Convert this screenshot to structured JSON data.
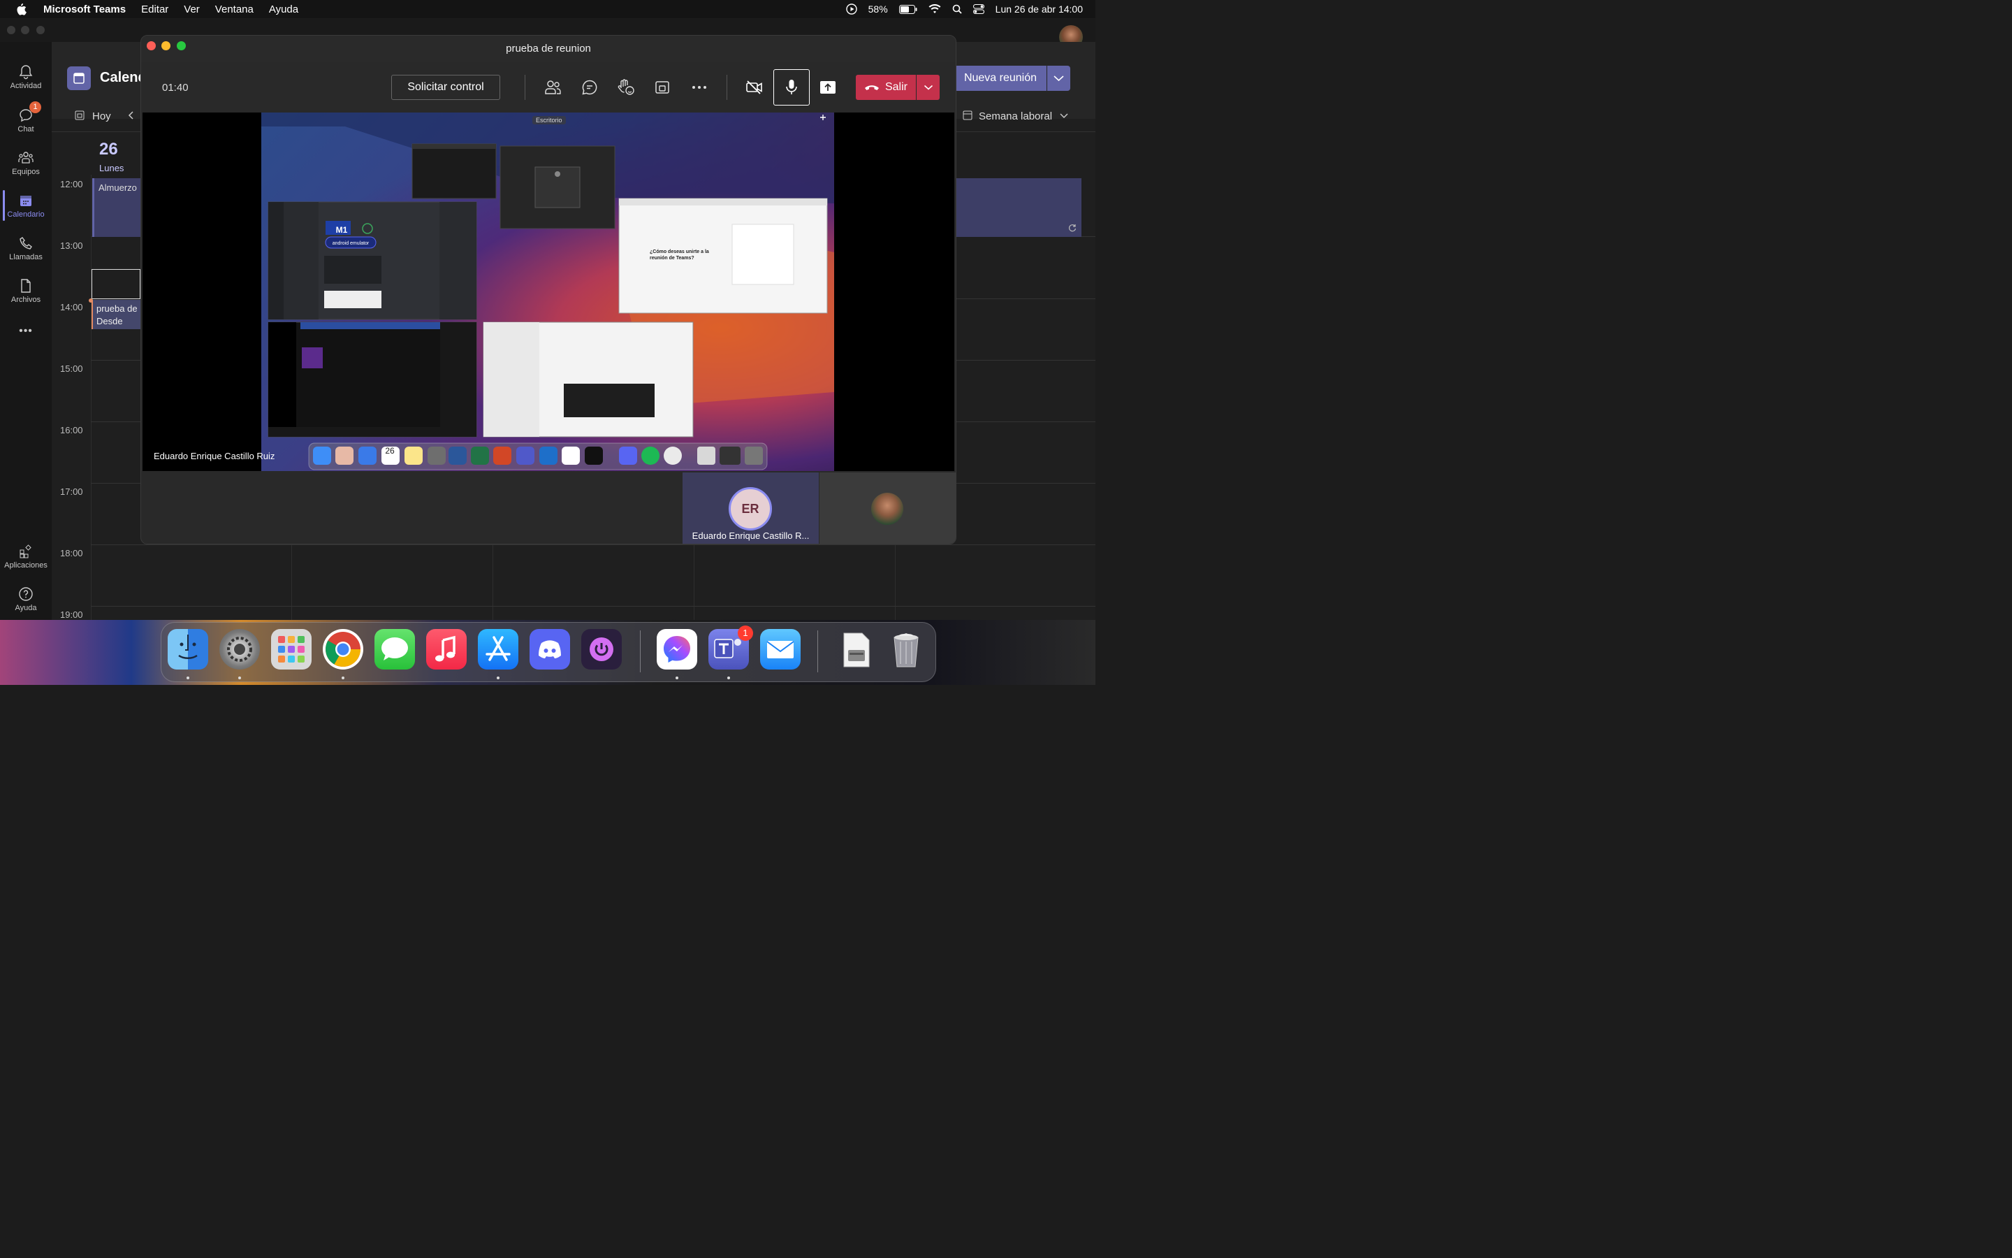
{
  "menubar": {
    "app_name": "Microsoft Teams",
    "menus": [
      "Editar",
      "Ver",
      "Ventana",
      "Ayuda"
    ],
    "battery": "58%",
    "datetime": "Lun 26 de abr  14:00"
  },
  "rail": {
    "items": [
      {
        "label": "Actividad",
        "icon": "bell-icon"
      },
      {
        "label": "Chat",
        "icon": "chat-icon",
        "badge": "1"
      },
      {
        "label": "Equipos",
        "icon": "teams-icon"
      },
      {
        "label": "Calendario",
        "icon": "calendar-icon",
        "active": true
      },
      {
        "label": "Llamadas",
        "icon": "phone-icon"
      },
      {
        "label": "Archivos",
        "icon": "file-icon"
      }
    ],
    "more": "•••",
    "apps_label": "Aplicaciones",
    "help_label": "Ayuda"
  },
  "calendar": {
    "title": "Calend",
    "new_meeting": "Nueva reunión",
    "today": "Hoy",
    "view": "Semana laboral",
    "day_number": "26",
    "day_name": "Lunes",
    "hours": [
      "12:00",
      "13:00",
      "14:00",
      "15:00",
      "16:00",
      "17:00",
      "18:00",
      "19:00"
    ],
    "events": {
      "lunch": "Almuerzo",
      "meeting_title": "prueba de",
      "meeting_sub": "Desde nues"
    }
  },
  "meeting": {
    "title": "prueba de reunion",
    "timer": "01:40",
    "request_control": "Solicitar control",
    "leave": "Salir",
    "desktop_label": "Escritorio",
    "shared_by": "Eduardo Enrique Castillo Ruiz",
    "thumb_m1": "M1",
    "thumb_emulator": "android emulator",
    "join_question": "¿Cómo deseas unirte a la reunión de Teams?",
    "participant_initials": "ER",
    "participant_name": "Eduardo Enrique Castillo R...",
    "mini_dock_date": "26"
  },
  "colors": {
    "accent": "#6264a7",
    "leave": "#c4314b",
    "badge": "#e5643c"
  },
  "dock": {
    "apps": [
      "Finder",
      "Preferencias del Sistema",
      "Launchpad",
      "Google Chrome",
      "Mensajes",
      "Música",
      "App Store",
      "Discord",
      "Power",
      "Messenger",
      "Microsoft Teams",
      "Mail",
      "Documentos",
      "Papelera"
    ],
    "teams_badge": "1"
  }
}
